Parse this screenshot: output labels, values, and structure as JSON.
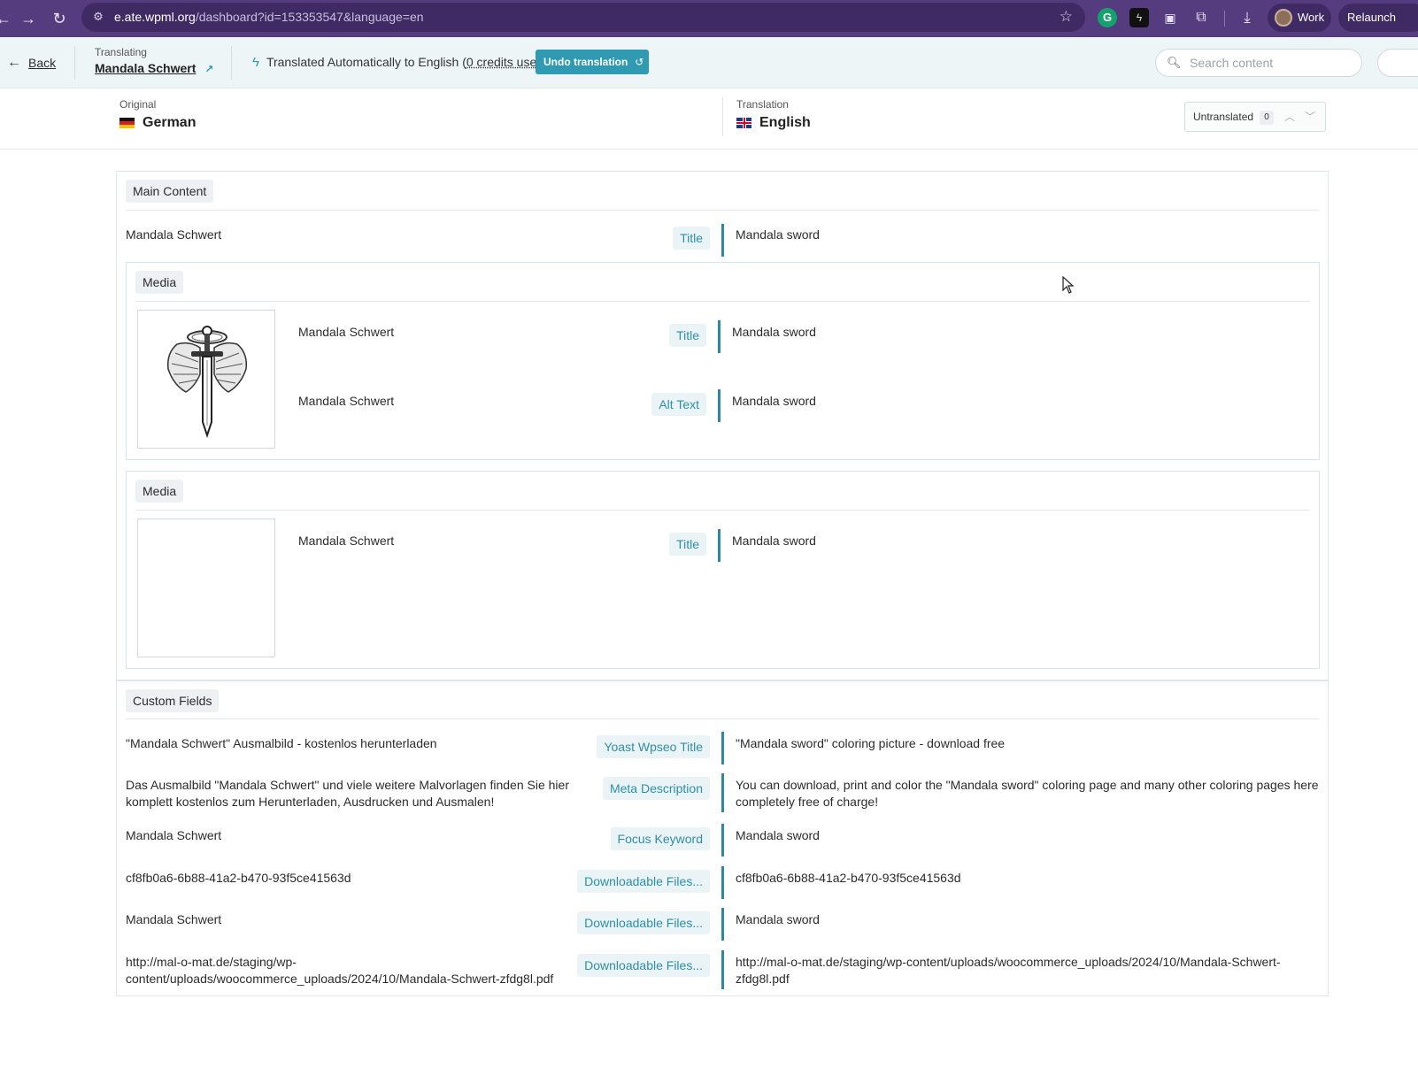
{
  "browser": {
    "nav": {
      "back_icon": "arrow-left-icon",
      "forward_icon": "arrow-right-icon",
      "reload_icon": "reload-icon"
    },
    "url_host": "e.ate.wpml.org",
    "url_rest": "/dashboard?id=153353547&language=en",
    "profile_label": "Work",
    "relaunch_label": "Relaunch"
  },
  "topbar": {
    "back_label": "Back",
    "translating_caption": "Translating",
    "post_title": "Mandala Schwert",
    "auto_prefix": "Translated Automatically to English (",
    "credits_text": "0 credits used",
    "auto_suffix": ")",
    "undo_label": "Undo translation",
    "search_placeholder": "Search content"
  },
  "languages": {
    "original_caption": "Original",
    "original_lang": "German",
    "translation_caption": "Translation",
    "translation_lang": "English",
    "filter_label": "Untranslated",
    "filter_count": "0"
  },
  "main": {
    "section_label": "Main Content",
    "title_row": {
      "source": "Mandala Schwert",
      "field": "Title",
      "target": "Mandala sword"
    },
    "media": [
      {
        "label": "Media",
        "rows": [
          {
            "source": "Mandala Schwert",
            "field": "Title",
            "target": "Mandala sword"
          },
          {
            "source": "Mandala Schwert",
            "field": "Alt Text",
            "target": "Mandala sword"
          }
        ]
      },
      {
        "label": "Media",
        "rows": [
          {
            "source": "Mandala Schwert",
            "field": "Title",
            "target": "Mandala sword"
          }
        ]
      }
    ]
  },
  "custom_fields": {
    "section_label": "Custom Fields",
    "rows": [
      {
        "source": "\"Mandala Schwert\" Ausmalbild - kostenlos herunterladen",
        "field": "Yoast Wpseo Title",
        "target": "\"Mandala sword\" coloring picture - download free"
      },
      {
        "source_1": "Das Ausmalbild \"Mandala Schwert\" und viele weitere Malvorlagen finden Sie hier",
        "source_2": "komplett kostenlos zum Herunterladen, Ausdrucken und Ausmalen!",
        "field": "Meta Description",
        "target_1": "You can download, print and color the \"Mandala sword\" coloring page and many other coloring pages here",
        "target_2": "completely free of charge!"
      },
      {
        "source": "Mandala Schwert",
        "field": "Focus Keyword",
        "target": "Mandala sword"
      },
      {
        "source": "cf8fb0a6-6b88-41a2-b470-93f5ce41563d",
        "field": "Downloadable Files...",
        "target": "cf8fb0a6-6b88-41a2-b470-93f5ce41563d"
      },
      {
        "source": "Mandala Schwert",
        "field": "Downloadable Files...",
        "target": "Mandala sword"
      },
      {
        "source_1": "http://mal-o-mat.de/staging/wp-",
        "source_2": "content/uploads/woocommerce_uploads/2024/10/Mandala-Schwert-zfdg8l.pdf",
        "field": "Downloadable Files...",
        "target_1": "http://mal-o-mat.de/staging/wp-content/uploads/woocommerce_uploads/2024/10/Mandala-Schwert-",
        "target_2": "zfdg8l.pdf"
      }
    ]
  },
  "colors": {
    "chrome": "#553c7f",
    "accent": "#2f9ab1",
    "field_text": "#2f8ea6"
  }
}
